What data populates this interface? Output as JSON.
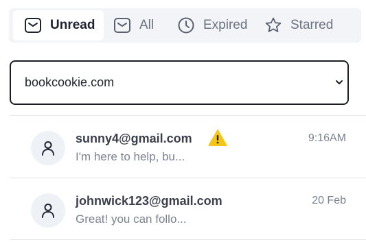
{
  "tabs": [
    {
      "label": "Unread",
      "icon": "envelope-icon",
      "active": true
    },
    {
      "label": "All",
      "icon": "envelope-icon",
      "active": false
    },
    {
      "label": "Expired",
      "icon": "clock-icon",
      "active": false
    },
    {
      "label": "Starred",
      "icon": "star-icon",
      "active": false
    }
  ],
  "domain_select": {
    "value": "bookcookie.com"
  },
  "messages": [
    {
      "email": "sunny4@gmail.com",
      "preview": "I'm here to help, bu...",
      "time": "9:16AM",
      "warning": true
    },
    {
      "email": "johnwick123@gmail.com",
      "preview": "Great! you can follo...",
      "time": "20 Feb",
      "warning": false
    }
  ],
  "colors": {
    "warning": "#f5c518",
    "active_tab_bg": "#ffffff",
    "tabs_bg": "#f2f4f7"
  }
}
